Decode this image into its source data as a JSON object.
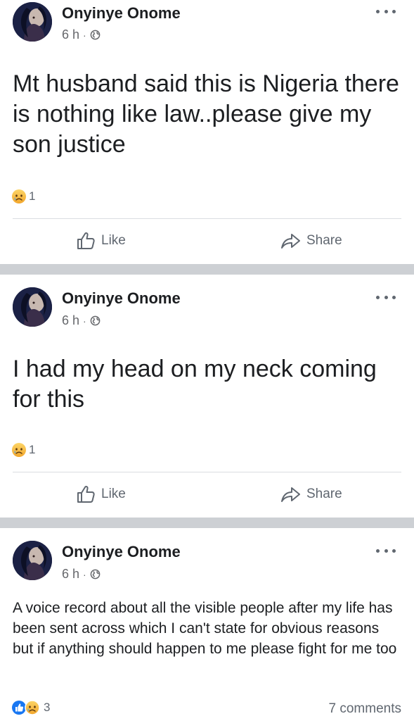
{
  "posts": [
    {
      "author": "Onyinye Onome",
      "time": "6 h",
      "text": "Mt husband said this is Nigeria there is nothing like law..please give my son justice",
      "reaction_count": "1",
      "reactions": [
        "sad-icon"
      ],
      "like_label": "Like",
      "share_label": "Share"
    },
    {
      "author": "Onyinye Onome",
      "time": "6 h",
      "text": "I had my head on my neck coming for this",
      "reaction_count": "1",
      "reactions": [
        "sad-icon"
      ],
      "like_label": "Like",
      "share_label": "Share"
    },
    {
      "author": "Onyinye Onome",
      "time": "6 h",
      "text": "A voice record about all the visible people after my life has been sent across which I can't state for obvious reasons but if anything should happen to me please fight for me too",
      "reaction_count": "3",
      "reactions": [
        "like-icon",
        "sad-icon"
      ],
      "comments": "7 comments"
    }
  ],
  "separator_dot": "·",
  "colors": {
    "like_blue": "#1877f2",
    "sad_yellow": "#f7b928",
    "separator": "#cdd0d4",
    "muted": "#65676b"
  }
}
